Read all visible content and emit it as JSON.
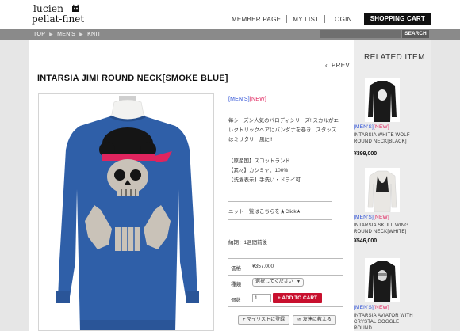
{
  "brand": {
    "line1": "lucien",
    "line2": "pellat-finet"
  },
  "topnav": {
    "member": "MEMBER PAGE",
    "mylist": "MY LIST",
    "login": "LOGIN",
    "cart": "SHOPPING CART"
  },
  "breadcrumb": [
    "TOP",
    "MEN'S",
    "KNIT"
  ],
  "search": {
    "button": "SEARCH",
    "value": ""
  },
  "product": {
    "prev": "PREV",
    "title": "INTARSIA JIMI ROUND NECK[SMOKE BLUE]",
    "tag_men": "[MEN'S]",
    "tag_new": "[NEW]",
    "desc": "毎シーズン人気のパロディシリーズ!!スカルがエレクトリックヘアにバンダナを巻き、スタッズはミリタリー風に!!",
    "spec_origin": "【原産国】スコットランド",
    "spec_material": "【素材】カシミヤ：100%",
    "spec_wash": "【洗濯表示】手洗い・ドライ可",
    "knit_link": "ニット一覧はこちらを★Click★",
    "delivery": "納期：1週間前後",
    "price_label": "価格",
    "price": "¥357,000",
    "type_label": "種類",
    "type_select": "選択してください",
    "qty_label": "個数",
    "qty": "1",
    "add_to_cart": "ADD TO CART",
    "mylist_btn": "マイリストに登録",
    "tell_btn": "友達に教える"
  },
  "related": {
    "title": "RELATED ITEM",
    "items": [
      {
        "tag_men": "[MEN'S]",
        "tag_new": "[NEW]",
        "name": "INTARSIA WHITE WOLF ROUND NECK[BLACK]",
        "price": "¥399,000"
      },
      {
        "tag_men": "[MEN'S]",
        "tag_new": "[NEW]",
        "name": "INTARSIA SKULL WING ROUND NECK[WHITE]",
        "price": "¥546,000"
      },
      {
        "tag_men": "[MEN'S]",
        "tag_new": "[NEW]",
        "name": "INTARSIA AVIATOR WITH CRYSTAL GOGGLE ROUND",
        "price": ""
      }
    ]
  },
  "colors": {
    "accent_red": "#c8102e",
    "tag_blue": "#2c4fd6",
    "tag_pink": "#e0245e",
    "sweater_blue": "#2f5fa8"
  }
}
